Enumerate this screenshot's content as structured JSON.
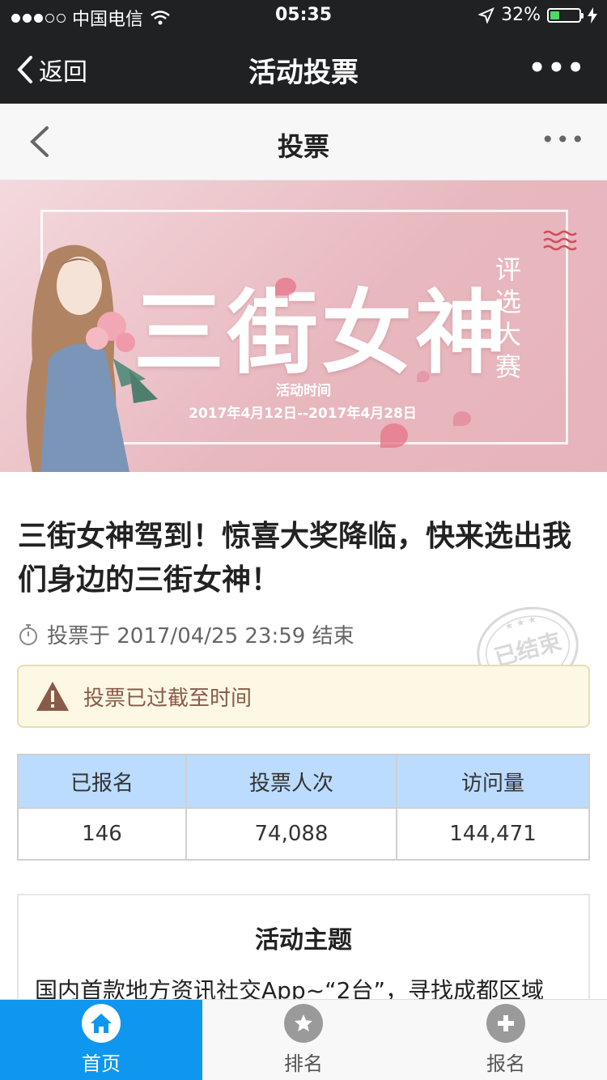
{
  "status_bar": {
    "carrier": "中国电信",
    "time": "05:35",
    "battery": "32%",
    "battery_level": 0.32
  },
  "wechat_header": {
    "back_label": "返回",
    "title": "活动投票"
  },
  "page_nav": {
    "title": "投票"
  },
  "banner": {
    "title": "三街女神",
    "vertical_text": "评选大赛",
    "subheading": "活动时间",
    "dates": "2017年4月12日--2017年4月28日"
  },
  "article": {
    "headline": "三街女神驾到！惊喜大奖降临，快来选出我们身边的三街女神！",
    "deadline": "投票于 2017/04/25 23:59 结束",
    "stamp_text": "已结束",
    "alert": "投票已过截至时间"
  },
  "stats": {
    "headers": [
      "已报名",
      "投票人次",
      "访问量"
    ],
    "values": [
      "146",
      "74,088",
      "144,471"
    ]
  },
  "theme": {
    "title": "活动主题",
    "text": "国内首款地方资讯社交App~“2台”，寻找成都区域"
  },
  "tabbar": {
    "items": [
      {
        "label": "首页",
        "icon": "home-icon",
        "active": true
      },
      {
        "label": "排名",
        "icon": "star-icon",
        "active": false
      },
      {
        "label": "报名",
        "icon": "plus-icon",
        "active": false
      }
    ]
  },
  "colors": {
    "tab_active": "#0f96ef",
    "table_header": "#bbdcff",
    "alert_bg": "#fcf8e3",
    "banner_pink": "#e8b8bf"
  }
}
